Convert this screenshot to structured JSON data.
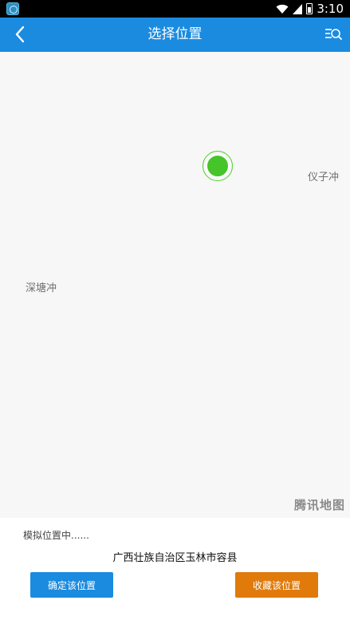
{
  "status_bar": {
    "time": "3:10",
    "battery_level": "3"
  },
  "header": {
    "title": "选择位置"
  },
  "map": {
    "labels": {
      "yizichong": "仪子冲",
      "shentangchong": "深塘冲"
    },
    "logo": "腾讯地图"
  },
  "panel": {
    "status_text": "模拟位置中......",
    "address": "广西壮族自治区玉林市容县",
    "confirm_label": "确定该位置",
    "collect_label": "收藏该位置"
  },
  "colors": {
    "header": "#1b8be0",
    "marker": "#46c52a",
    "confirm_button": "#1b8be0",
    "collect_button": "#e07a0a"
  },
  "icons": {
    "back": "back-arrow-icon",
    "search": "list-search-icon",
    "wifi": "wifi-icon",
    "signal": "signal-icon",
    "battery": "battery-icon"
  }
}
